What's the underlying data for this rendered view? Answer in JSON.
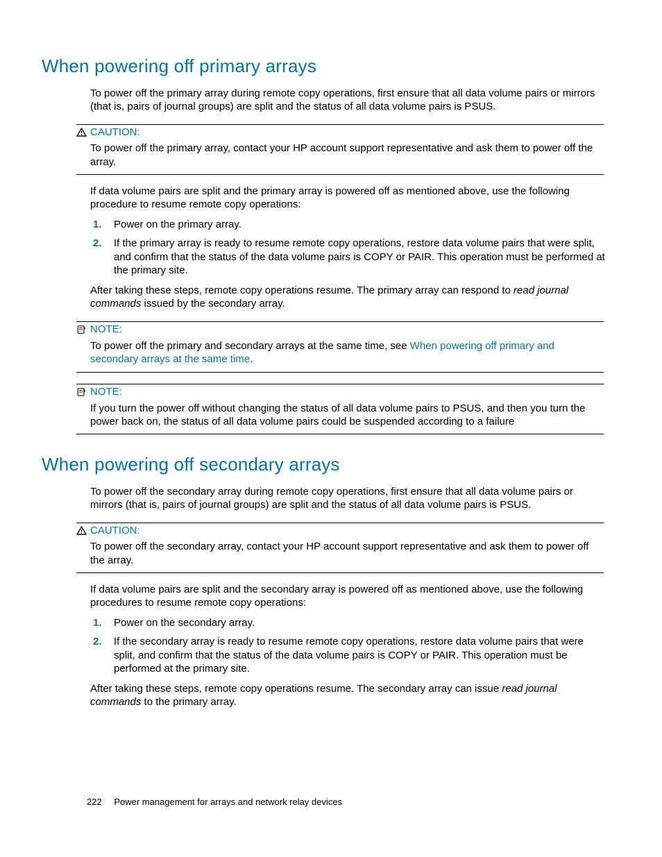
{
  "section1": {
    "heading": "When powering off primary arrays",
    "intro": "To power off the primary array during remote copy operations, first ensure that all data volume pairs or mirrors (that is, pairs of journal groups) are split and the status of all data volume pairs is PSUS.",
    "caution_label": "CAUTION:",
    "caution_body": "To power off the primary array, contact your HP account support representative and ask them to power off the array.",
    "resume_intro": "If data volume pairs are split and the primary array is powered off as mentioned above, use the following procedure to resume remote copy operations:",
    "steps": [
      "Power on the primary array.",
      "If the primary array is ready to resume remote copy operations, restore data volume pairs that were split, and confirm that the status of the data volume pairs is COPY or PAIR. This operation must be performed at the primary site."
    ],
    "after_a": "After taking these steps, remote copy operations resume. The primary array can respond to ",
    "after_italic": "read journal commands",
    "after_b": " issued by the secondary array.",
    "note1_label": "NOTE:",
    "note1_a": "To power off the primary and secondary arrays at the same time, see ",
    "note1_link": "When powering off primary and secondary arrays at the same time",
    "note1_b": ".",
    "note2_label": "NOTE:",
    "note2_body": "If you turn the power off without changing the status of all data volume pairs to PSUS, and then you turn the power back on, the status of all data volume pairs could be suspended according to a failure"
  },
  "section2": {
    "heading": "When powering off secondary arrays",
    "intro": "To power off the secondary array during remote copy operations, first ensure that all data volume pairs or mirrors (that is, pairs of journal groups) are split and the status of all data volume pairs is PSUS.",
    "caution_label": "CAUTION:",
    "caution_body": "To power off the secondary array, contact your HP account support representative and ask them to power off the array.",
    "resume_intro": "If data volume pairs are split and the secondary array is powered off as mentioned above, use the following procedures to resume remote copy operations:",
    "steps": [
      "Power on the secondary array.",
      "If the secondary array is ready to resume remote copy operations, restore data volume pairs that were split, and confirm that the status of the data volume pairs is COPY or PAIR. This operation must be performed at the primary site."
    ],
    "after_a": "After taking these steps, remote copy operations resume. The secondary array can issue ",
    "after_italic": "read journal commands",
    "after_b": " to the primary array."
  },
  "footer": {
    "page_number": "222",
    "chapter_title": "Power management for arrays and network relay devices"
  }
}
